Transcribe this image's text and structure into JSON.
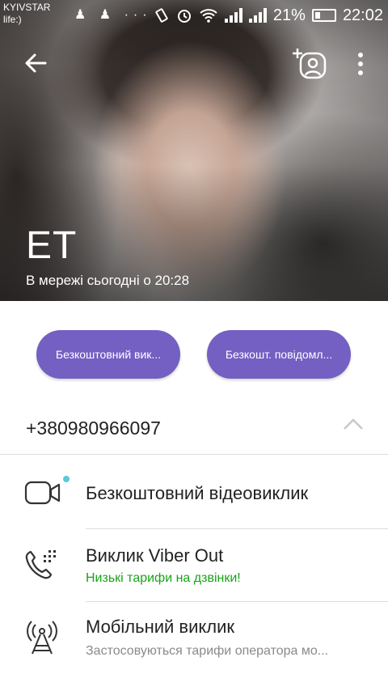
{
  "status_bar": {
    "carrier_line1": "KYIVSTAR",
    "carrier_line2": "life:)",
    "notif_icons": "♟ ♟ ···",
    "battery_percent": "21%",
    "time": "22:02"
  },
  "contact": {
    "name": "ЕТ",
    "last_seen": "В мережі сьогодні о 20:28",
    "phone": "+380980966097"
  },
  "actions": {
    "free_call_label": "Безкоштовний вик...",
    "free_message_label": "Безкошт. повідомл..."
  },
  "call_options": [
    {
      "title": "Безкоштовний відеовиклик",
      "subtitle": "",
      "icon": "video-camera-icon"
    },
    {
      "title": "Виклик Viber Out",
      "subtitle": "Низькі тарифи на дзвінки!",
      "subtitle_color": "#1aa31a",
      "icon": "phone-out-icon"
    },
    {
      "title": "Мобільний виклик",
      "subtitle": "Застосовуються тарифи оператора мо...",
      "subtitle_color": "#8a8a8a",
      "icon": "antenna-icon"
    }
  ],
  "colors": {
    "accent": "#7360c2",
    "online_dot": "#5ac8d8",
    "viber_out_green": "#1aa31a"
  }
}
